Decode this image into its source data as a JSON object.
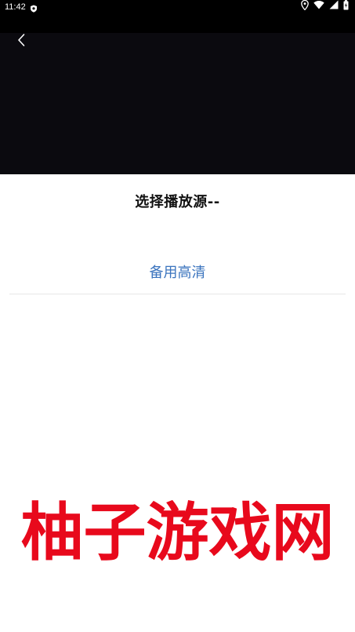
{
  "status_bar": {
    "time": "11:42",
    "icons": [
      "shield-icon",
      "location-icon",
      "wifi-icon",
      "signal-icon",
      "battery-icon"
    ]
  },
  "video": {
    "back_icon": "chevron-left-icon"
  },
  "main": {
    "title": "选择播放源--",
    "sources": [
      {
        "label": "备用高清"
      }
    ]
  },
  "watermark": {
    "text": "柚子游戏网",
    "color": "#e8091c"
  },
  "colors": {
    "accent": "#3b74be",
    "video_bg": "#0b0a0f"
  }
}
